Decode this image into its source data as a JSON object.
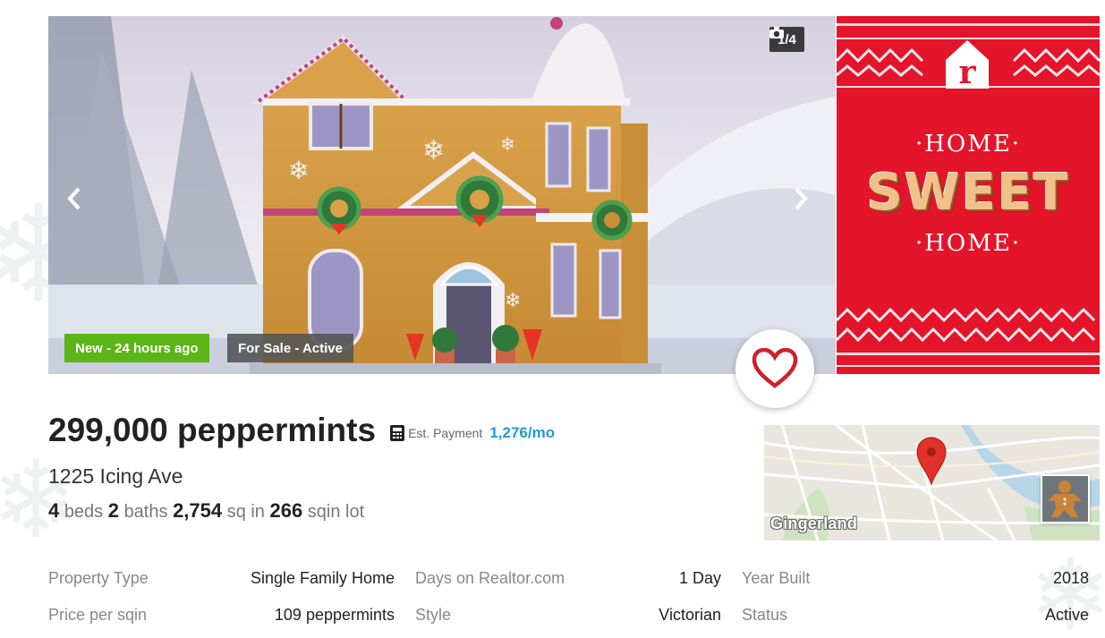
{
  "gallery": {
    "photo_counter": "1/4",
    "badge_new": "New - 24 hours ago",
    "badge_status": "For Sale - Active",
    "colors": {
      "badge_new": "#5bb516",
      "badge_status": "#555555"
    }
  },
  "promo": {
    "home_top": "·HOME·",
    "sweet": "SWEET",
    "home_bottom": "·HOME·",
    "background_color": "#e4142b"
  },
  "listing": {
    "price": "299,000 peppermints",
    "est_payment_label": "Est. Payment",
    "est_payment_value": "1,276/mo",
    "address": "1225 Icing Ave",
    "beds_value": "4",
    "beds_label": "beds",
    "baths_value": "2",
    "baths_label": "baths",
    "sq_value": "2,754",
    "sq_label": "sq in",
    "lot_value": "266",
    "lot_label": "sqin lot"
  },
  "map": {
    "label": "Gingerland"
  },
  "details": {
    "property_type_label": "Property Type",
    "property_type_value": "Single Family Home",
    "days_label": "Days on Realtor.com",
    "days_value": "1 Day",
    "year_built_label": "Year Built",
    "year_built_value": "2018",
    "price_per_label": "Price per sqin",
    "price_per_value": "109 peppermints",
    "style_label": "Style",
    "style_value": "Victorian",
    "status_label": "Status",
    "status_value": "Active"
  },
  "icons": [
    "chevron-left-icon",
    "chevron-right-icon",
    "camera-icon",
    "heart-icon",
    "calculator-icon",
    "map-pin-icon",
    "realtor-logo-icon"
  ],
  "accent_colors": {
    "link": "#1f9ad6",
    "heart": "#d0202b"
  }
}
